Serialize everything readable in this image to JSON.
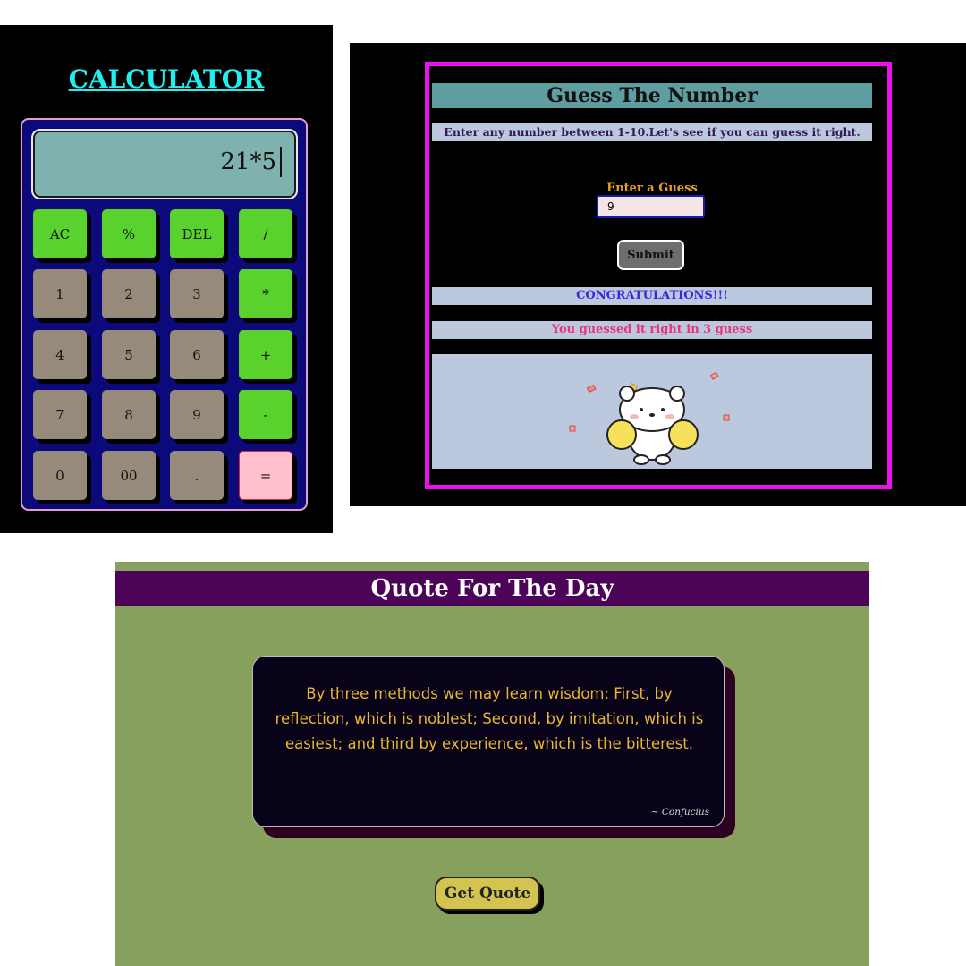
{
  "calculator": {
    "title": "CALCULATOR",
    "display": "21*5",
    "keys": [
      "AC",
      "%",
      "DEL",
      "/",
      "1",
      "2",
      "3",
      "*",
      "4",
      "5",
      "6",
      "+",
      "7",
      "8",
      "9",
      "-",
      "0",
      "00",
      ".",
      "="
    ]
  },
  "guess": {
    "title": "Guess The Number",
    "instruction": "Enter any number between 1-10.Let's see if you can guess it right.",
    "input_label": "Enter a Guess",
    "input_value": "9",
    "submit_label": "Submit",
    "congrats": "CONGRATULATIONS!!!",
    "result": "You guessed it right in 3 guess",
    "frame_color": "#ee11ee"
  },
  "quote": {
    "header": "Quote For The Day",
    "text": "By three methods we may learn wisdom: First, by reflection, which is noblest; Second, by imitation, which is easiest; and third by experience, which is the bitterest.",
    "author": "~ Confucius",
    "button_label": "Get Quote",
    "accent": "#4b0457"
  }
}
